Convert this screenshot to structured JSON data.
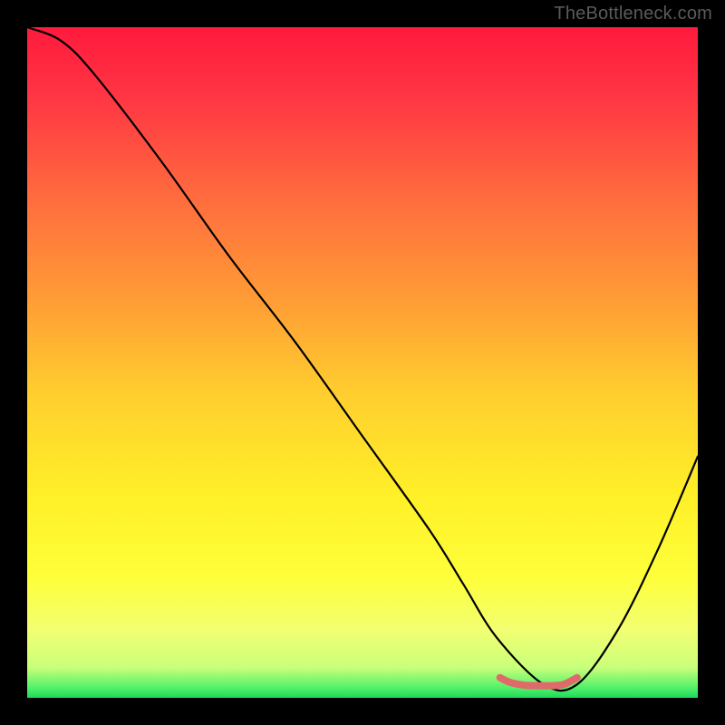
{
  "watermark": "TheBottleneck.com",
  "gradient": {
    "stops": [
      {
        "offset": 0.0,
        "color": "#ff1a3c"
      },
      {
        "offset": 0.1,
        "color": "#ff3444"
      },
      {
        "offset": 0.25,
        "color": "#ff6a3e"
      },
      {
        "offset": 0.4,
        "color": "#ff9a36"
      },
      {
        "offset": 0.55,
        "color": "#ffcf2e"
      },
      {
        "offset": 0.7,
        "color": "#fff028"
      },
      {
        "offset": 0.82,
        "color": "#feff3a"
      },
      {
        "offset": 0.9,
        "color": "#f2ff72"
      },
      {
        "offset": 0.955,
        "color": "#c9ff7a"
      },
      {
        "offset": 0.985,
        "color": "#53f06a"
      },
      {
        "offset": 1.0,
        "color": "#1fd95c"
      }
    ]
  },
  "chart_data": {
    "type": "line",
    "title": "",
    "xlabel": "",
    "ylabel": "",
    "xlim": [
      0,
      100
    ],
    "ylim": [
      0,
      100
    ],
    "series": [
      {
        "name": "curve",
        "x": [
          0,
          5,
          10,
          20,
          30,
          40,
          50,
          60,
          65,
          70,
          77,
          82,
          88,
          94,
          100
        ],
        "values": [
          100,
          98,
          93,
          80,
          66,
          53,
          39,
          25,
          17,
          9,
          2,
          2,
          10,
          22,
          36
        ]
      }
    ],
    "highlight": {
      "name": "bottom-segment",
      "color": "#e06a6a",
      "x": [
        70.5,
        72,
        74,
        76,
        78,
        80,
        82
      ],
      "values": [
        3.0,
        2.3,
        1.9,
        1.8,
        1.8,
        2.0,
        3.0
      ]
    }
  }
}
